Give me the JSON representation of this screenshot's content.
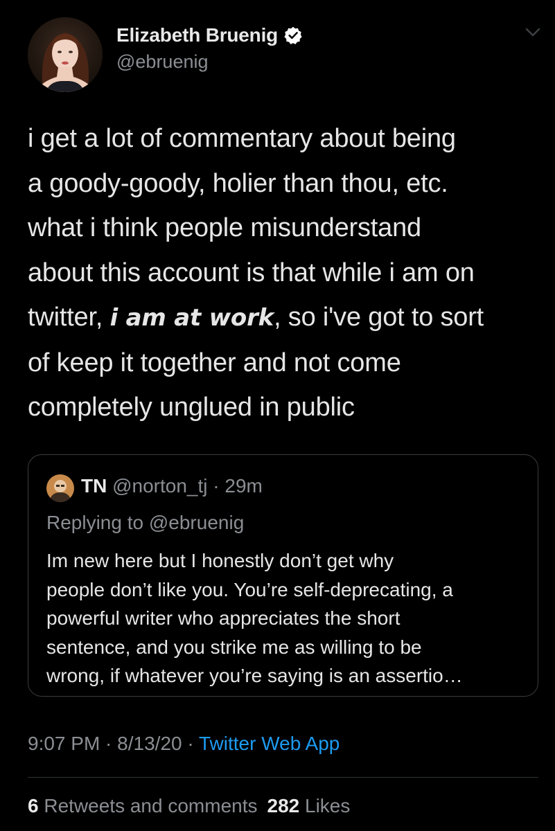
{
  "author": {
    "display_name": "Elizabeth Bruenig",
    "handle": "@ebruenig",
    "verified": true,
    "avatar_icon": "profile-photo"
  },
  "tweet": {
    "lines": [
      {
        "text": "i get a lot of commentary about being"
      },
      {
        "text": "a goody-goody, holier than thou, etc."
      },
      {
        "text": "what i think people misunderstand"
      },
      {
        "text": "about this account is that while i am on"
      },
      {
        "before": "twitter, ",
        "emphasis": "i am at work",
        "after": ", so i've got to sort"
      },
      {
        "text": "of keep it together and not come"
      },
      {
        "text": "completely unglued in public"
      }
    ]
  },
  "quoted": {
    "name": "TN",
    "handle": "@norton_tj",
    "separator": " · ",
    "time": "29m",
    "replying_to": "Replying to @ebruenig",
    "lines": [
      "Im new here but I honestly don’t get why",
      "people don’t like you. You’re self-deprecating, a",
      "powerful writer who appreciates the short",
      "sentence, and you strike me as willing to be",
      "wrong, if whatever you’re saying is an assertio…"
    ]
  },
  "meta": {
    "time": "9:07 PM",
    "sep1": " · ",
    "date": "8/13/20",
    "sep2": " · ",
    "source": "Twitter Web App"
  },
  "stats": {
    "retweets_count": "6",
    "retweets_label": "Retweets and comments",
    "likes_count": "282",
    "likes_label": "Likes"
  },
  "colors": {
    "background": "#000000",
    "text": "#e6e6e6",
    "secondary": "#8b8e93",
    "link": "#1d9bf0",
    "border": "#3a3d41",
    "verified_badge": "#ffffff"
  },
  "icons": {
    "verified": "verified-badge-icon",
    "more": "chevron-down-icon"
  }
}
